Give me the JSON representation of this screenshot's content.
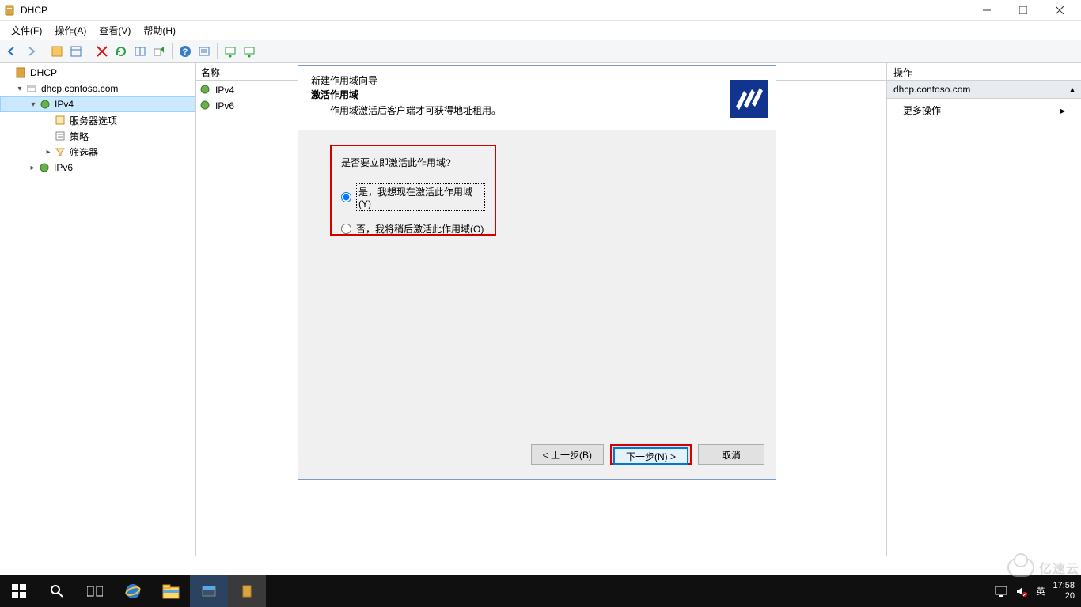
{
  "titlebar": {
    "title": "DHCP"
  },
  "menubar": {
    "file": "文件(F)",
    "action": "操作(A)",
    "view": "查看(V)",
    "help": "帮助(H)"
  },
  "tree": {
    "root": "DHCP",
    "server": "dhcp.contoso.com",
    "ipv4": "IPv4",
    "ipv4_children": {
      "server_options": "服务器选项",
      "policies": "策略",
      "filters": "筛选器"
    },
    "ipv6": "IPv6"
  },
  "list": {
    "header": "名称",
    "ipv4": "IPv4",
    "ipv6": "IPv6"
  },
  "actions": {
    "header": "操作",
    "section": "dhcp.contoso.com",
    "more": "更多操作"
  },
  "wizard": {
    "window_title": "新建作用域向导",
    "heading": "激活作用域",
    "description": "作用域激活后客户端才可获得地址租用。",
    "question": "是否要立即激活此作用域?",
    "opt_yes": "是，我想现在激活此作用域(Y)",
    "opt_no": "否，我将稍后激活此作用域(O)",
    "btn_back": "< 上一步(B)",
    "btn_next": "下一步(N) >",
    "btn_cancel": "取消"
  },
  "taskbar": {
    "ime": "英",
    "time": "17:58",
    "date_abbrev": "20"
  },
  "watermark": "亿速云"
}
